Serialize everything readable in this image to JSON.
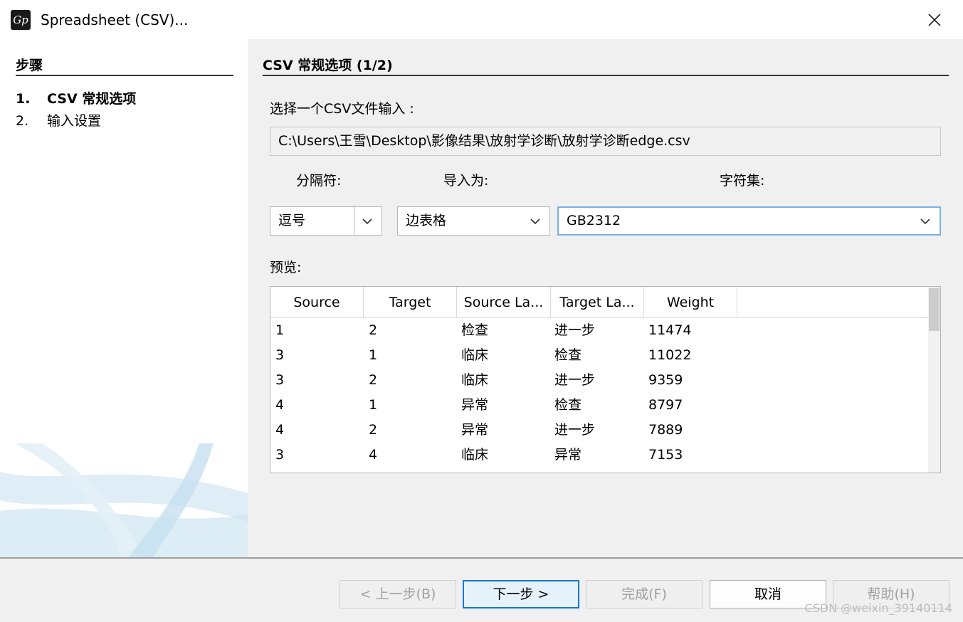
{
  "window": {
    "title": "Spreadsheet (CSV)...",
    "app_icon_text": "Gp",
    "close_icon": "close-x-icon"
  },
  "steps": {
    "title": "步骤",
    "items": [
      {
        "num": "1.",
        "label": "CSV 常规选项",
        "active": true
      },
      {
        "num": "2.",
        "label": "输入设置",
        "active": false
      }
    ]
  },
  "main": {
    "section_title": "CSV 常规选项 (1/2)",
    "file_label": "选择一个CSV文件输入 :",
    "file_path": "C:\\Users\\王雪\\Desktop\\影像结果\\放射学诊断\\放射学诊断edge.csv",
    "separator_label": "分隔符:",
    "import_as_label": "导入为:",
    "charset_label": "字符集:",
    "separator_value": "逗号",
    "import_as_value": "边表格",
    "charset_value": "GB2312",
    "preview_label": "预览:"
  },
  "preview": {
    "columns": [
      "Source",
      "Target",
      "Source La...",
      "Target La...",
      "Weight"
    ],
    "rows": [
      [
        "1",
        "2",
        "检查",
        "进一步",
        "11474"
      ],
      [
        "3",
        "1",
        "临床",
        "检查",
        "11022"
      ],
      [
        "3",
        "2",
        "临床",
        "进一步",
        "9359"
      ],
      [
        "4",
        "1",
        "异常",
        "检查",
        "8797"
      ],
      [
        "4",
        "2",
        "异常",
        "进一步",
        "7889"
      ],
      [
        "3",
        "4",
        "临床",
        "异常",
        "7153"
      ]
    ]
  },
  "buttons": {
    "back": "< 上一步(B)",
    "next": "下一步 >",
    "finish": "完成(F)",
    "cancel": "取消",
    "help": "帮助(H)"
  },
  "watermark": "CSDN @weixin_39140114",
  "colors": {
    "focus_border": "#7ab0e6",
    "primary_border": "#0078d7",
    "panel_bg": "#f0f0f0"
  }
}
